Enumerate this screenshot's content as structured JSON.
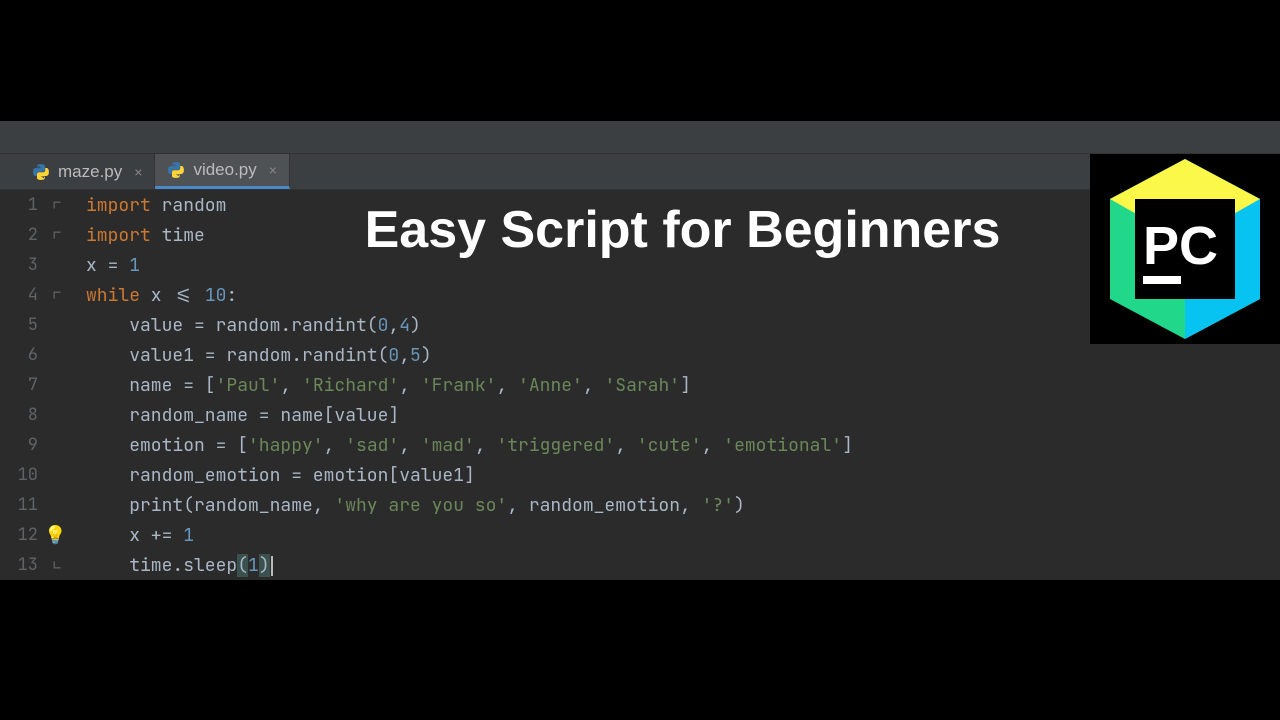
{
  "tabs": [
    {
      "label": "maze.py",
      "active": false
    },
    {
      "label": "video.py",
      "active": true
    }
  ],
  "overlay_title": "Easy Script for Beginners",
  "code_lines": [
    {
      "n": 1,
      "fold": "open",
      "bulb": false,
      "html": "<span class='kw'>import</span> random"
    },
    {
      "n": 2,
      "fold": "open",
      "bulb": false,
      "html": "<span class='kw'>import</span> time"
    },
    {
      "n": 3,
      "fold": "",
      "bulb": false,
      "html": "x = <span class='num'>1</span>"
    },
    {
      "n": 4,
      "fold": "open",
      "bulb": false,
      "html": "<span class='kw'>while</span> x &lt;= <span class='num'>10</span>:"
    },
    {
      "n": 5,
      "fold": "",
      "bulb": false,
      "html": "    value = random.randint(<span class='num'>0</span><span class='py'>,</span><span class='num'>4</span>)"
    },
    {
      "n": 6,
      "fold": "",
      "bulb": false,
      "html": "    value1 = random.randint(<span class='num'>0</span><span class='py'>,</span><span class='num'>5</span>)"
    },
    {
      "n": 7,
      "fold": "",
      "bulb": false,
      "html": "    name = [<span class='str'>'Paul'</span>, <span class='str'>'Richard'</span>, <span class='str'>'Frank'</span>, <span class='str'>'Anne'</span>, <span class='str'>'Sarah'</span>]"
    },
    {
      "n": 8,
      "fold": "",
      "bulb": false,
      "html": "    random_name = name[value]"
    },
    {
      "n": 9,
      "fold": "",
      "bulb": false,
      "html": "    emotion = [<span class='str'>'happy'</span>, <span class='str'>'sad'</span>, <span class='str'>'mad'</span>, <span class='str'>'triggered'</span>, <span class='str'>'cute'</span>, <span class='str'>'emotional'</span>]"
    },
    {
      "n": 10,
      "fold": "",
      "bulb": false,
      "html": "    random_emotion = emotion[value1]"
    },
    {
      "n": 11,
      "fold": "",
      "bulb": false,
      "html": "    <span class='fn'>print</span>(random_name, <span class='str'>'why are you so'</span>, random_emotion, <span class='str'>'?'</span>)"
    },
    {
      "n": 12,
      "fold": "",
      "bulb": true,
      "html": "    x += <span class='num'>1</span>"
    },
    {
      "n": 13,
      "fold": "close",
      "bulb": false,
      "html": "    time.sleep<span class='brkt-hl'>(</span><span class='num'>1</span><span class='brkt-hl'>)</span><span class='caret'></span>"
    }
  ],
  "logo_text": "PC"
}
